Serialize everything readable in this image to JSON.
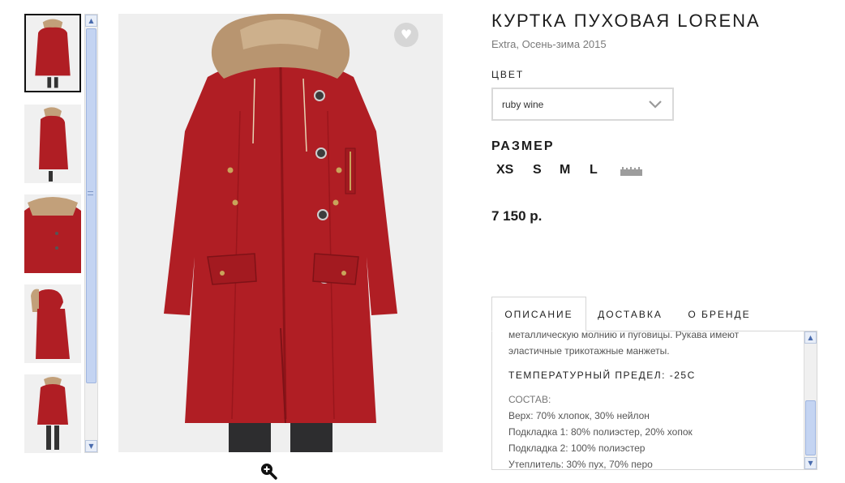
{
  "product": {
    "title": "КУРТКА ПУХОВАЯ LORENA",
    "subtitle": "Extra, Осень-зима 2015",
    "color_label": "ЦВЕТ",
    "color_value": "ruby wine",
    "size_label": "РАЗМЕР",
    "sizes": [
      "XS",
      "S",
      "M",
      "L"
    ],
    "price": "7 150 р."
  },
  "tabs": [
    "ОПИСАНИЕ",
    "ДОСТАВКА",
    "О БРЕНДЕ"
  ],
  "description": {
    "lines": [
      "металлическую молнию и пуговицы. Рукава имеют",
      "эластичные трикотажные манжеты."
    ],
    "temperature": "ТЕМПЕРАТУРНЫЙ ПРЕДЕЛ: -25С",
    "composition_title": "СОСТАВ:",
    "composition": [
      "Верх: 70% хлопок, 30% нейлон",
      "Подкладка 1: 80% полиэстер, 20% хопок",
      "Подкладка 2: 100% полиэстер",
      "Утеплитель: 30% пух, 70% перо"
    ]
  },
  "icons": {
    "wishlist": "heart-icon",
    "zoom": "zoom-in-icon",
    "size_chart": "ruler-icon",
    "dropdown": "chevron-down-icon"
  },
  "colors": {
    "coat": "#b01e24",
    "fur": "#b89570",
    "scrollbar": "#c4d4f2"
  }
}
